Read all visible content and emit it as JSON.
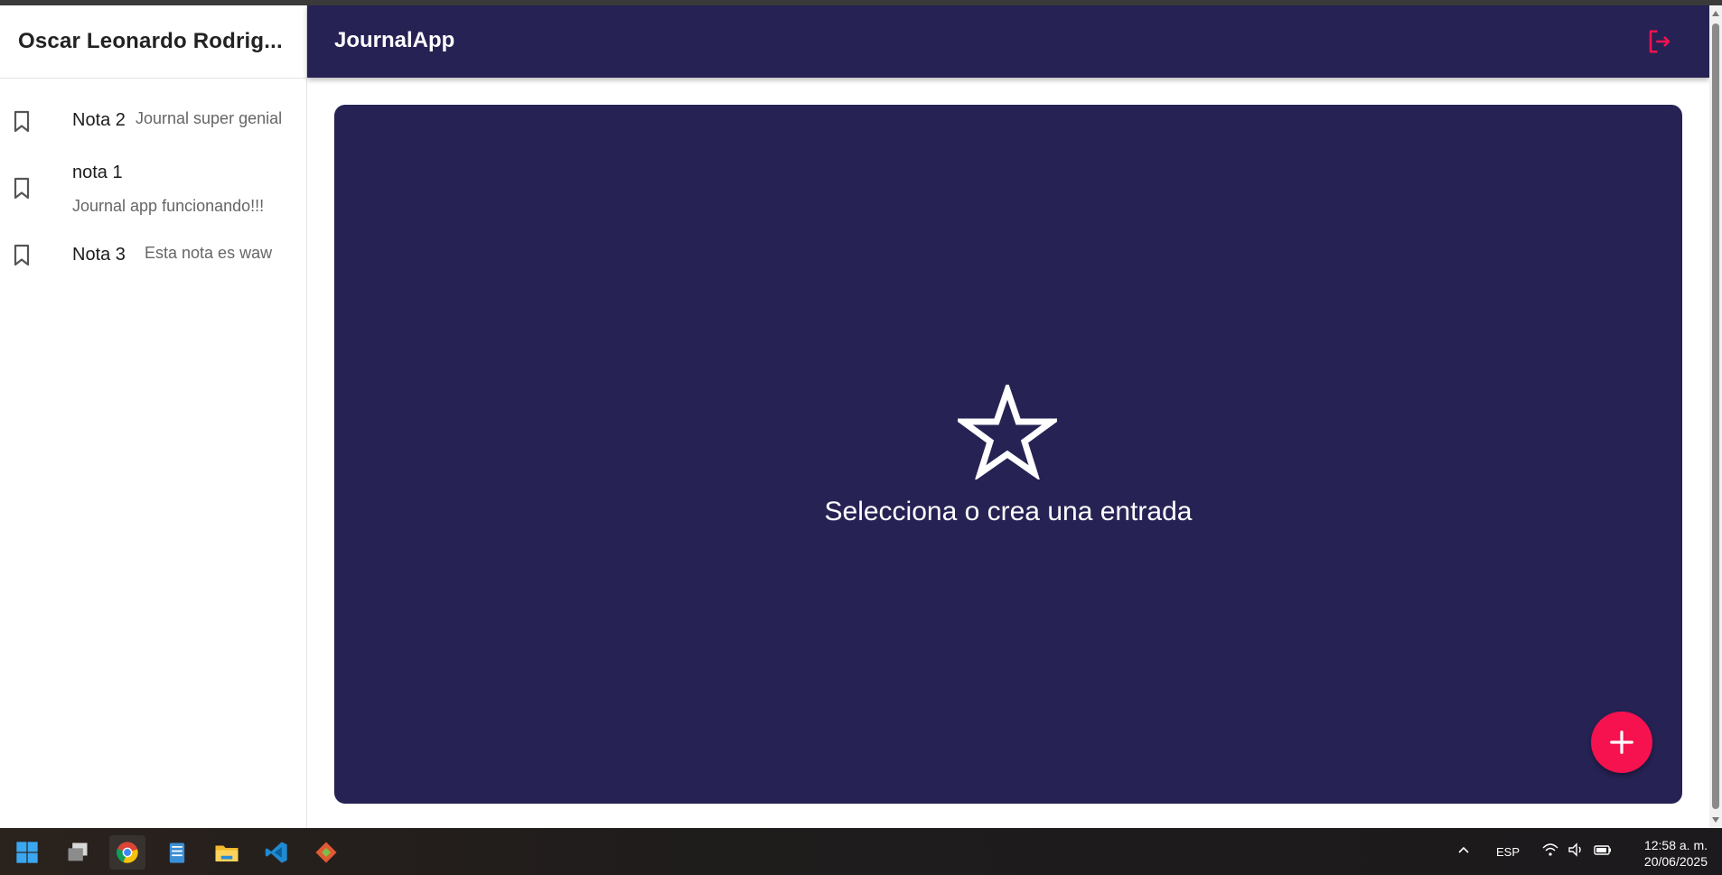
{
  "sidebar": {
    "user_name": "Oscar Leonardo Rodrig...",
    "notes": [
      {
        "title": "Nota 2",
        "body": "Journal super genial"
      },
      {
        "title": "nota 1",
        "body": "Journal app funcionando!!!"
      },
      {
        "title": "Nota 3",
        "body": "Esta nota es waw"
      }
    ]
  },
  "header": {
    "title": "JournalApp",
    "logout_icon": "logout-icon"
  },
  "main": {
    "empty_icon": "star-outline-icon",
    "empty_message": "Selecciona o crea una entrada",
    "fab_icon": "add-icon"
  },
  "colors": {
    "primary": "#262254",
    "accent": "#f5124f",
    "background": "#ffffff"
  },
  "taskbar": {
    "apps": [
      "windows-start-icon",
      "task-view-icon",
      "chrome-icon",
      "notepad-icon",
      "file-explorer-icon",
      "vscode-icon",
      "git-icon"
    ],
    "language": "ESP",
    "time": "12:58 a. m.",
    "date": "20/06/2025"
  }
}
